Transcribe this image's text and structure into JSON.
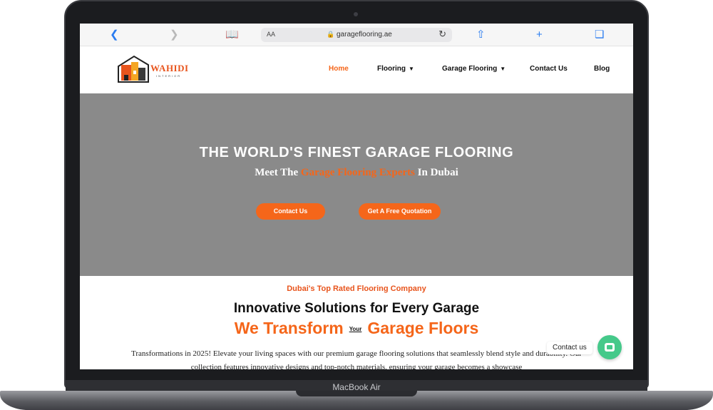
{
  "device": {
    "model_label": "MacBook Air"
  },
  "browser": {
    "aa_label": "AA",
    "lock_icon": "🔒",
    "url": "garageflooring.ae",
    "icons": [
      "back-icon",
      "forward-icon",
      "bookmarks-icon",
      "reload-icon",
      "share-icon",
      "new-tab-icon",
      "tabs-icon"
    ]
  },
  "site": {
    "logo_text": "WAHIDI",
    "logo_subtext": "INTERIOR",
    "nav": [
      {
        "label": "Home",
        "active": true
      },
      {
        "label": "Flooring",
        "has_dropdown": true
      },
      {
        "label": "Garage Flooring",
        "has_dropdown": true
      },
      {
        "label": "Contact Us"
      },
      {
        "label": "Blog"
      }
    ]
  },
  "hero": {
    "title": "THE WORLD'S FINEST GARAGE FLOORING",
    "sub_pre": "Meet The ",
    "sub_accent": "Garage Flooring Experts",
    "sub_post": " In Dubai",
    "buttons": {
      "contact": "Contact Us",
      "quote": "Get A Free Quotation"
    }
  },
  "content": {
    "eyebrow": "Dubai's Top Rated Flooring Company",
    "heading": "Innovative Solutions for Every Garage",
    "heading2_pre": "We Transform",
    "heading2_small": "Your",
    "heading2_post": "Garage Floors",
    "paragraph": "Transformations in 2025! Elevate your living spaces with our premium garage flooring solutions that seamlessly blend style and durability. Our collection features innovative designs and top-notch materials, ensuring your garage becomes a showcase"
  },
  "widget": {
    "label": "Contact us"
  },
  "colors": {
    "accent": "#f5661a",
    "hero_bg": "#8a8a8a",
    "widget": "#45c98a"
  }
}
